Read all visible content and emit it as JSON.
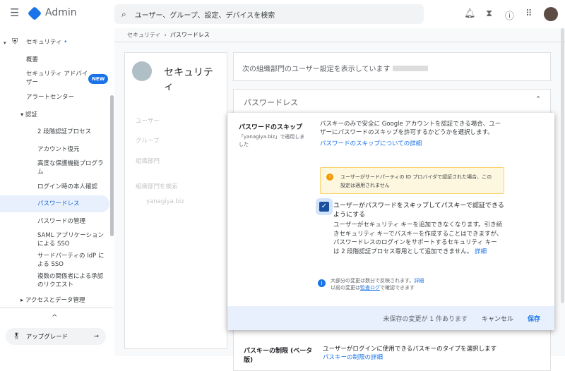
{
  "header": {
    "app_title": "Admin",
    "search_placeholder": "ユーザー、グループ、設定、デバイスを検索"
  },
  "sidebar": {
    "section": "セキュリティ",
    "items": [
      "概要",
      "セキュリティ アドバイザー",
      "アラートセンター"
    ],
    "new_badge": "NEW",
    "auth": "認証",
    "auth_items": [
      "2 段階認証プロセス",
      "アカウント復元",
      "高度な保護機能プログラム",
      "ログイン時の本人確認",
      "パスワードレス",
      "パスワードの管理",
      "SAML アプリケーションによる SSO",
      "サードパーティの IdP による SSO",
      "複数の関係者による承認のリクエスト"
    ],
    "access": "アクセスとデータ管理",
    "upgrade": "アップグレード"
  },
  "breadcrumb": {
    "parent": "セキュリティ",
    "current": "パスワードレス"
  },
  "org_panel": {
    "title": "セキュリティ",
    "users": "ユーザー",
    "groups": "グループ",
    "org_units": "組織部門",
    "search": "組織部門を検索",
    "org": "yanagiya.biz"
  },
  "main": {
    "showing": "次の組織部門のユーザー設定を表示しています",
    "section": "パスワードレス",
    "skip": {
      "title": "パスワードのスキップ",
      "applied": "「yanagiya.biz」で適用しました",
      "desc": "パスキーのみで安全に Google アカウントを認証できる場合、ユーザーにパスワードのスキップを許可するかどうかを選択します。",
      "learn": "パスワードのスキップについての詳細",
      "warning": "ユーザーがサードパーティの ID プロバイダで認証された場合、この設定は適用されません",
      "checkbox_label": "ユーザーがパスワードをスキップしてパスキーで認証できるようにする",
      "checked": true,
      "checkbox_desc": "ユーザーがセキュリティ キーを追加できなくなります。引き続きセキュリティ キーでパスキーを作成することはできますが、パスワードレスのログインをサポートするセキュリティ キーは 2 段階認証プロセス専用として追加できません。",
      "details": "詳細",
      "info1": "大部分の変更は数分で反映されます。",
      "info_details": "詳細",
      "info2a": "以前の変更は",
      "audit": "監査ログ",
      "info2b": "で確認できます"
    },
    "footer": {
      "unsaved": "未保存の変更が 1 件あります",
      "cancel": "キャンセル",
      "save": "保存"
    },
    "passkey": {
      "title": "パスキーの制限 (ベータ版)",
      "desc": "ユーザーがログインに使用できるパスキーのタイプを選択します",
      "learn": "パスキーの制限の詳細"
    }
  }
}
